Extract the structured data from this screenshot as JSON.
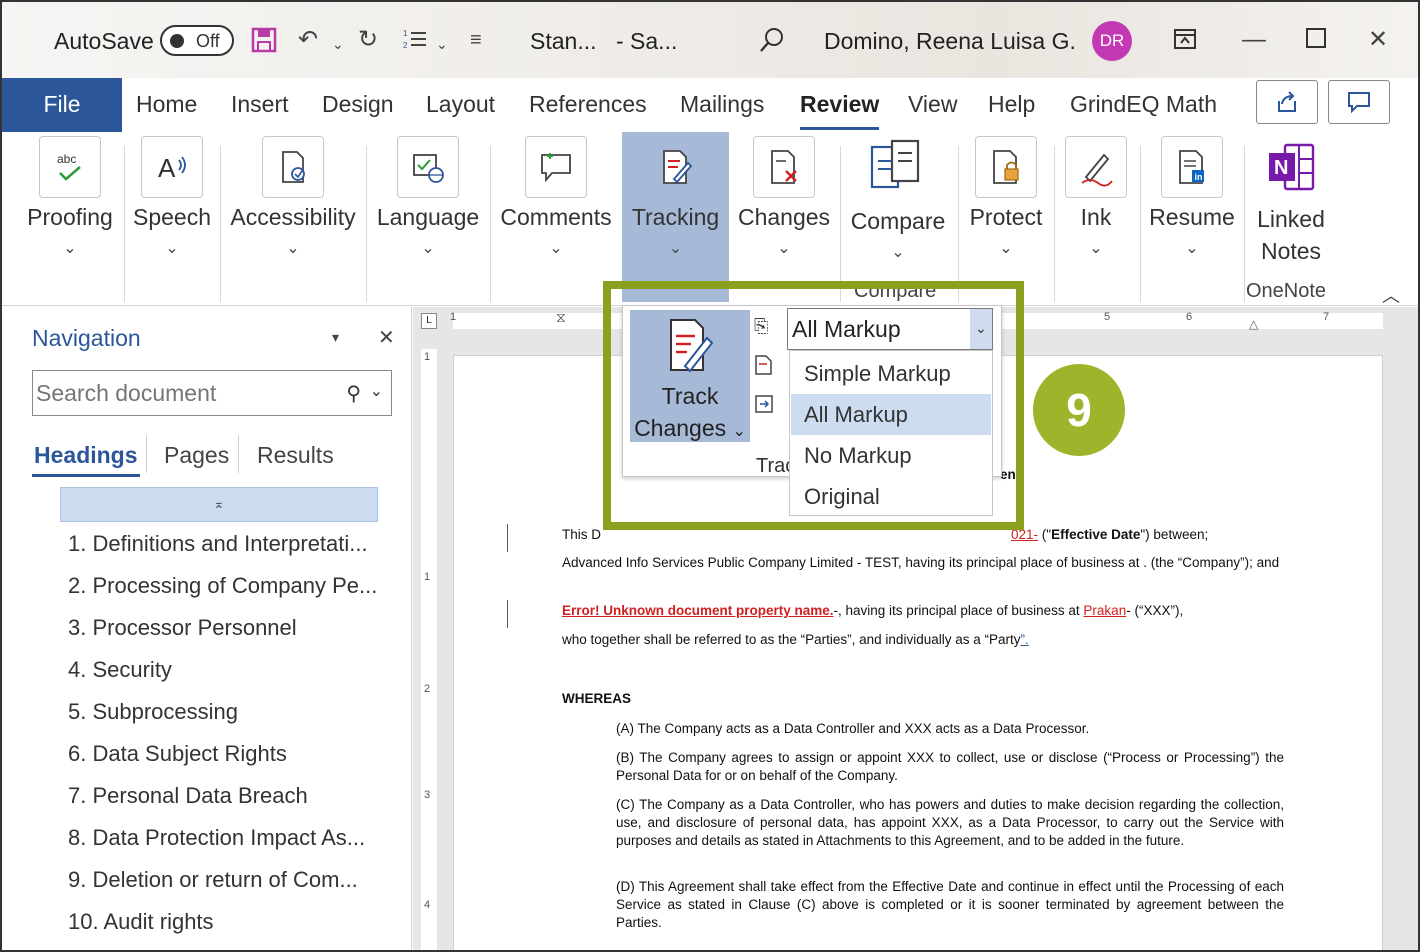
{
  "titlebar": {
    "autosave_label": "AutoSave",
    "autosave_state": "Off",
    "doc_name": "Stan...",
    "doc_status": "- Sa...",
    "user_name": "Domino, Reena Luisa G.",
    "user_initials": "DR"
  },
  "tabs": [
    "File",
    "Home",
    "Insert",
    "Design",
    "Layout",
    "References",
    "Mailings",
    "Review",
    "View",
    "Help",
    "GrindEQ Math"
  ],
  "active_tab": "Review",
  "ribbon": {
    "groups": [
      {
        "label": "Proofing",
        "icon": "spelling-check-icon"
      },
      {
        "label": "Speech",
        "icon": "read-aloud-icon"
      },
      {
        "label": "Accessibility",
        "icon": "accessibility-check-icon"
      },
      {
        "label": "Language",
        "icon": "language-icon"
      },
      {
        "label": "Comments",
        "icon": "comment-icon"
      },
      {
        "label": "Tracking",
        "icon": "track-changes-icon"
      },
      {
        "label": "Changes",
        "icon": "changes-icon"
      },
      {
        "label": "Compare",
        "icon": "compare-icon"
      },
      {
        "label": "Protect",
        "icon": "protect-lock-icon"
      },
      {
        "label": "Ink",
        "icon": "ink-pen-icon"
      },
      {
        "label": "Resume",
        "icon": "resume-icon"
      }
    ],
    "linked_notes": {
      "line1": "Linked",
      "line2": "Notes",
      "footer": "OneNote"
    },
    "compare_footer": "Compare"
  },
  "navigation": {
    "title": "Navigation",
    "search_placeholder": "Search document",
    "tabs": [
      "Headings",
      "Pages",
      "Results"
    ],
    "active_tab": "Headings",
    "headings": [
      "1. Definitions and Interpretati...",
      "2. Processing of Company Pe...",
      "3. Processor Personnel",
      "4. Security",
      "5. Subprocessing",
      "6. Data Subject Rights",
      "7. Personal Data Breach",
      "8. Data Protection Impact As...",
      "9. Deletion or return of Com...",
      "10. Audit rights"
    ]
  },
  "track_changes": {
    "button_line1": "Track",
    "button_line2": "Changes",
    "group_label": "Trac",
    "markup_selected": "All Markup",
    "markup_options": [
      "Simple Markup",
      "All Markup",
      "No Markup",
      "Original"
    ],
    "badge": "9"
  },
  "document": {
    "line1_a": "This D",
    "line1_c": "021-",
    "line1_d": " (\"",
    "line1_bold": "Effective Date",
    "line1_e": "\") between;",
    "en_fragment": "en",
    "company_para": "Advanced Info Services Public Company Limited - TEST, having its principal place of business at . (the “Company”); and",
    "error_text": "Error! Unknown document property name.",
    "xxx_para_a": "-, having its principal place of business at ",
    "prakan": "Prakan",
    "xxx_para_b": "- (“XXX”),",
    "parties_para": "who together shall be referred to as the “Parties”, and individually as a “Party",
    "parties_end": "”.",
    "whereas": "WHEREAS",
    "a": "(A) The Company acts as a Data Controller and XXX acts as a Data Processor.",
    "b": "(B) The Company agrees to assign or appoint XXX to collect, use or disclose (“Process or Processing”) the Personal Data for or on behalf of the Company.",
    "c": "(C) The Company as a Data Controller, who has powers and duties to make decision regarding the collection, use, and disclosure of personal data, has appoint XXX, as a Data Processor, to carry out the Service with purposes and details as stated in Attachments to this Agreement, and to be added in the future.",
    "d": "(D) This Agreement shall take effect from the Effective Date and continue in effect until the Processing of each Service as stated in Clause (C) above is completed or it is sooner terminated by agreement between the Parties."
  },
  "ruler": {
    "h_numbers": [
      "1",
      "5",
      "6",
      "7"
    ],
    "v_numbers": [
      "1",
      "1",
      "2",
      "3",
      "4"
    ]
  },
  "colors": {
    "word_blue": "#2b579a",
    "highlight_green": "#8ca01f",
    "badge_green": "#a0b42b",
    "selected_group": "#a6b9d6",
    "avatar": "#c239b3"
  }
}
